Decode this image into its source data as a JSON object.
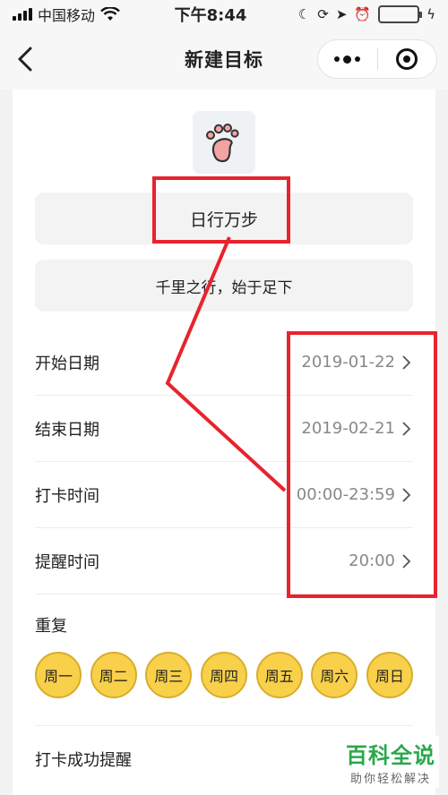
{
  "status_bar": {
    "carrier": "中国移动",
    "time": "下午8:44",
    "battery_color": "#3cc43c"
  },
  "nav": {
    "title": "新建目标",
    "back_icon": "chevron-left-icon",
    "more_icon": "more-dots-icon",
    "close_icon": "target-circle-icon"
  },
  "goal": {
    "icon": "footprint-icon",
    "name": "日行万步",
    "slogan": "千里之行，始于足下"
  },
  "settings": [
    {
      "label": "开始日期",
      "value": "2019-01-22"
    },
    {
      "label": "结束日期",
      "value": "2019-02-21"
    },
    {
      "label": "打卡时间",
      "value": "00:00-23:59"
    },
    {
      "label": "提醒时间",
      "value": "20:00"
    }
  ],
  "repeat": {
    "label": "重复",
    "days": [
      "周一",
      "周二",
      "周三",
      "周四",
      "周五",
      "周六",
      "周日"
    ],
    "day_color": "#f8d04a"
  },
  "success_reminder": {
    "label": "打卡成功提醒"
  },
  "annotation_color": "#e8232e",
  "watermark": {
    "title": "百科全说",
    "subtitle": "助你轻松解决"
  }
}
